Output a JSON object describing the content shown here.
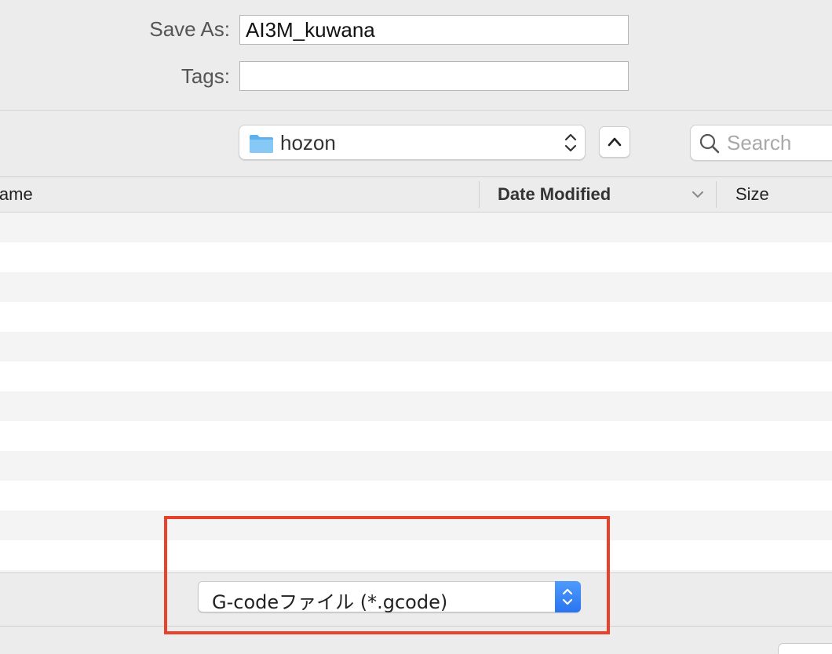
{
  "save_as": {
    "label": "Save As:",
    "value": "AI3M_kuwana"
  },
  "tags": {
    "label": "Tags:",
    "value": ""
  },
  "location": {
    "folder_name": "hozon",
    "folder_icon": "folder-icon",
    "stepper_icon": "up-down-chevron-icon",
    "up_icon": "chevron-up-icon"
  },
  "search": {
    "placeholder": "Search",
    "icon": "magnifier-icon"
  },
  "columns": {
    "name": "Name",
    "date_modified": "Date Modified",
    "size": "Size",
    "sort_indicator": "chevron-down-icon"
  },
  "file_list": {
    "rows": []
  },
  "format": {
    "selected": "G-codeファイル (*.gcode)",
    "stepper_icon": "up-down-chevron-icon"
  },
  "colors": {
    "highlight": "#e8412c",
    "accent": "#2a74f0",
    "folder": "#6cb8f2"
  }
}
